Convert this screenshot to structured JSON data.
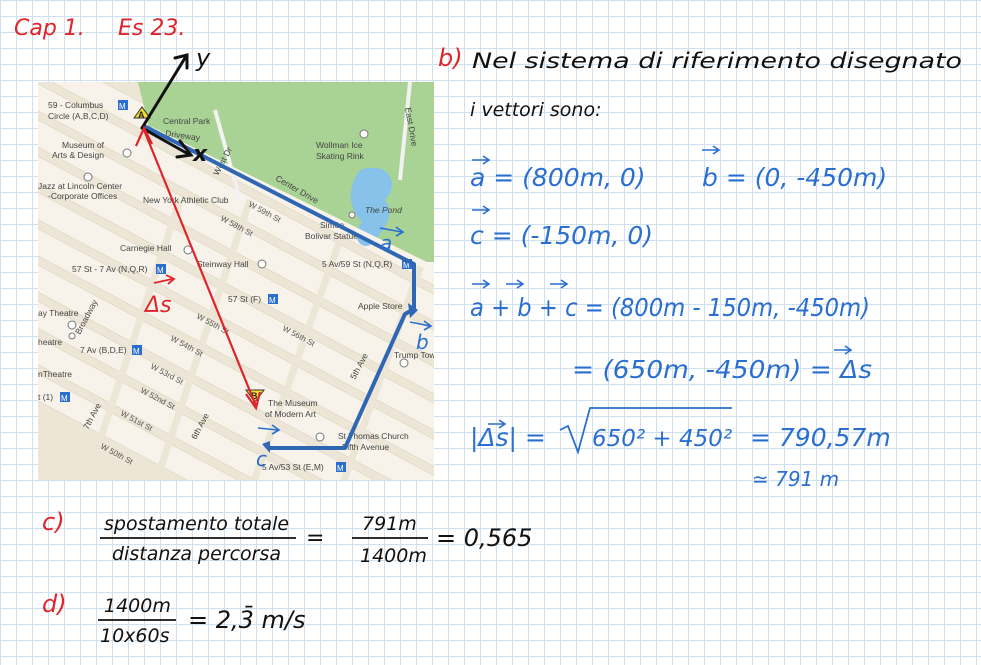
{
  "colors": {
    "red_ink": "#e0242b",
    "blue_ink": "#2a6fd0",
    "black_ink": "#111111",
    "route": "#2f67b5",
    "park": "#a9d395",
    "water": "#86c2ea",
    "road_bg": "#ede6d6"
  },
  "header": {
    "chapter": "Cap 1.",
    "exercise": "Es 23."
  },
  "axes": {
    "y": "y",
    "x": "x"
  },
  "map": {
    "labels": {
      "columbus": "59 - Columbus",
      "columbus2": "Circle (A,B,C,D)",
      "central_park": "Central Park",
      "driveway": "Driveway",
      "museum_arts": "Museum of",
      "museum_arts2": "Arts & Design",
      "jazz": "Jazz at Lincoln Center",
      "jazz2": "-Corporate Offices",
      "nyac": "New York Athletic Club",
      "west_dr": "West Dr",
      "wollman": "Wollman Ice",
      "wollman2": "Skating Rink",
      "east_drive": "East Drive",
      "center_drive": "Center Drive",
      "the_pond": "The Pond",
      "simon": "Simón",
      "simon2": "Bolivar Statue",
      "carnegie": "Carnegie Hall",
      "steinway": "Steinway Hall",
      "st57_7av": "57 St - 7 Av (N,Q,R)",
      "st57_f": "57 St (F)",
      "av5_59": "5 Av/59 St (N,Q,R)",
      "apple": "Apple Store",
      "trump": "Trump Towe",
      "theatre1": "ay Theatre",
      "theatre2": "heatre",
      "theatre3": "nTheatre",
      "broadway": "Broadway",
      "av7_bde": "7 Av (B,D,E)",
      "it1": "t (1)",
      "ave7": "7th Ave",
      "ave6": "6th Ave",
      "ave5": "5th Ave",
      "moma": "The Museum",
      "moma2": "of Modern Art",
      "st_thomas": "St Thomas Church",
      "st_thomas2": "Fifth Avenue",
      "av5_53": "5 Av/53 St (E,M)",
      "w59": "W 59th St",
      "w58": "W 58th St",
      "w57": "W 57th St",
      "w56": "W 56th St",
      "w55": "W 55th St",
      "w54": "W 54th St",
      "w53": "W 53rd St",
      "w52": "W 52nd St",
      "w51": "W 51st St",
      "w50": "W 50th St",
      "pin_a": "A",
      "pin_b": "B",
      "subway": "M"
    },
    "annotations": {
      "vec_a": "a",
      "vec_b": "b",
      "vec_c": "c",
      "delta_s": "Δs"
    }
  },
  "part_b": {
    "label": "b)",
    "line1": "Nel sistema di riferimento disegnato",
    "line2": "i vettori sono:",
    "a_vec": "a = (800m, 0)",
    "b_vec": "b = (0, -450m)",
    "c_vec": "c = (-150m, 0)",
    "sum_lhs": "a + b + c = (800m - 150m, -450m)",
    "sum_rhs": "= (650m, -450m) = Δs",
    "mod_lhs": "|Δs| =",
    "mod_rad": "650² + 450²",
    "mod_res": "= 790,57m",
    "mod_approx": "≃ 791 m"
  },
  "part_c": {
    "label": "c)",
    "num": "spostamento totale",
    "den": "distanza percorsa",
    "eq": "=",
    "num2": "791m",
    "den2": "1400m",
    "result": "= 0,565"
  },
  "part_d": {
    "label": "d)",
    "num": "1400m",
    "den": "10x60s",
    "result": "= 2,3̄ m/s"
  }
}
